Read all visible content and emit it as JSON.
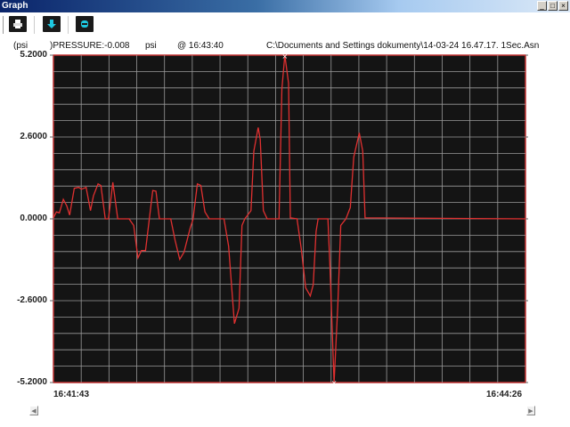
{
  "window": {
    "title": "Graph",
    "minimize": "_",
    "maximize": "□",
    "close": "×"
  },
  "toolbar": {
    "icons": [
      "printer-icon",
      "download-icon",
      "stop-icon"
    ]
  },
  "info": {
    "unit_prefix": "(psi",
    "reading": ")PRESSURE:-0.008",
    "unit": "psi",
    "timestamp": "@ 16:43:40",
    "file": "C:\\Documents and Settings dokumenty\\14-03-24 16.47.17. 1Sec.Asn"
  },
  "colors": {
    "plot_bg": "#141414",
    "grid": "#9a9a9a",
    "trace": "#e03030",
    "frame": "#c03030"
  },
  "chart_data": {
    "type": "line",
    "title": "",
    "xlabel": "",
    "ylabel": "psi",
    "x_unit": "seconds since 16:41:43",
    "xlim": [
      0,
      163
    ],
    "ylim": [
      -5.2,
      5.2
    ],
    "y_ticks": [
      "5.2000",
      "2.6000",
      "0.0000",
      "-2.6000",
      "-5.2000"
    ],
    "y_tick_values": [
      5.2,
      2.6,
      0,
      -2.6,
      -5.2
    ],
    "x_tick_labels": [
      "16:41:43",
      "16:44:26"
    ],
    "grid": true,
    "grid_divisions": {
      "x": 17,
      "y": 20
    },
    "series": [
      {
        "name": "PRESSURE",
        "x": [
          0,
          1.0,
          2.05,
          3.4,
          4.6,
          5.6,
          7.2,
          8.7,
          9.7,
          11.3,
          12.8,
          13.8,
          15.4,
          16.4,
          17.9,
          19.0,
          20.5,
          22.2,
          26.1,
          27.7,
          29.2,
          30.4,
          31.8,
          34.3,
          35.4,
          36.6,
          40.5,
          42.0,
          43.6,
          45.1,
          47.2,
          48.2,
          49.7,
          50.9,
          52.3,
          53.8,
          58.9,
          60.5,
          62.5,
          64.1,
          65.1,
          66.1,
          68.2,
          69.2,
          70.7,
          71.4,
          72.5,
          73.8,
          77.9,
          78.9,
          79.9,
          81.2,
          81.8,
          84.1,
          85.6,
          87.1,
          88.7,
          89.7,
          90.7,
          91.4,
          94.8,
          95.5,
          96.9,
          98.2,
          99.2,
          101.0,
          102.5,
          103.7,
          105.6,
          106.8,
          107.6,
          163
        ],
        "y": [
          0.03,
          0.22,
          0.19,
          0.62,
          0.41,
          0.12,
          0.97,
          1.0,
          0.94,
          1.0,
          0.26,
          0.73,
          1.11,
          1.06,
          0,
          0,
          1.16,
          0,
          0,
          -0.21,
          -1.24,
          -1.01,
          -1.01,
          0.9,
          0.88,
          0,
          0,
          -0.68,
          -1.29,
          -1.06,
          -0.3,
          -0.02,
          1.11,
          1.06,
          0.22,
          0,
          0,
          -0.87,
          -3.33,
          -2.84,
          -0.21,
          0,
          0.26,
          2.15,
          2.9,
          2.52,
          0.26,
          0,
          0,
          4.13,
          5.2,
          4.31,
          0.03,
          0,
          -0.96,
          -2.19,
          -2.45,
          -2.09,
          -0.4,
          0,
          0,
          -1.53,
          -5.2,
          -2.75,
          -0.21,
          0,
          0.36,
          1.96,
          2.73,
          2.15,
          0.03,
          0
        ]
      }
    ],
    "markers": [
      {
        "label": "max",
        "x": 79.9,
        "y": 5.2
      },
      {
        "label": "min",
        "x": 96.9,
        "y": -5.2
      }
    ]
  }
}
